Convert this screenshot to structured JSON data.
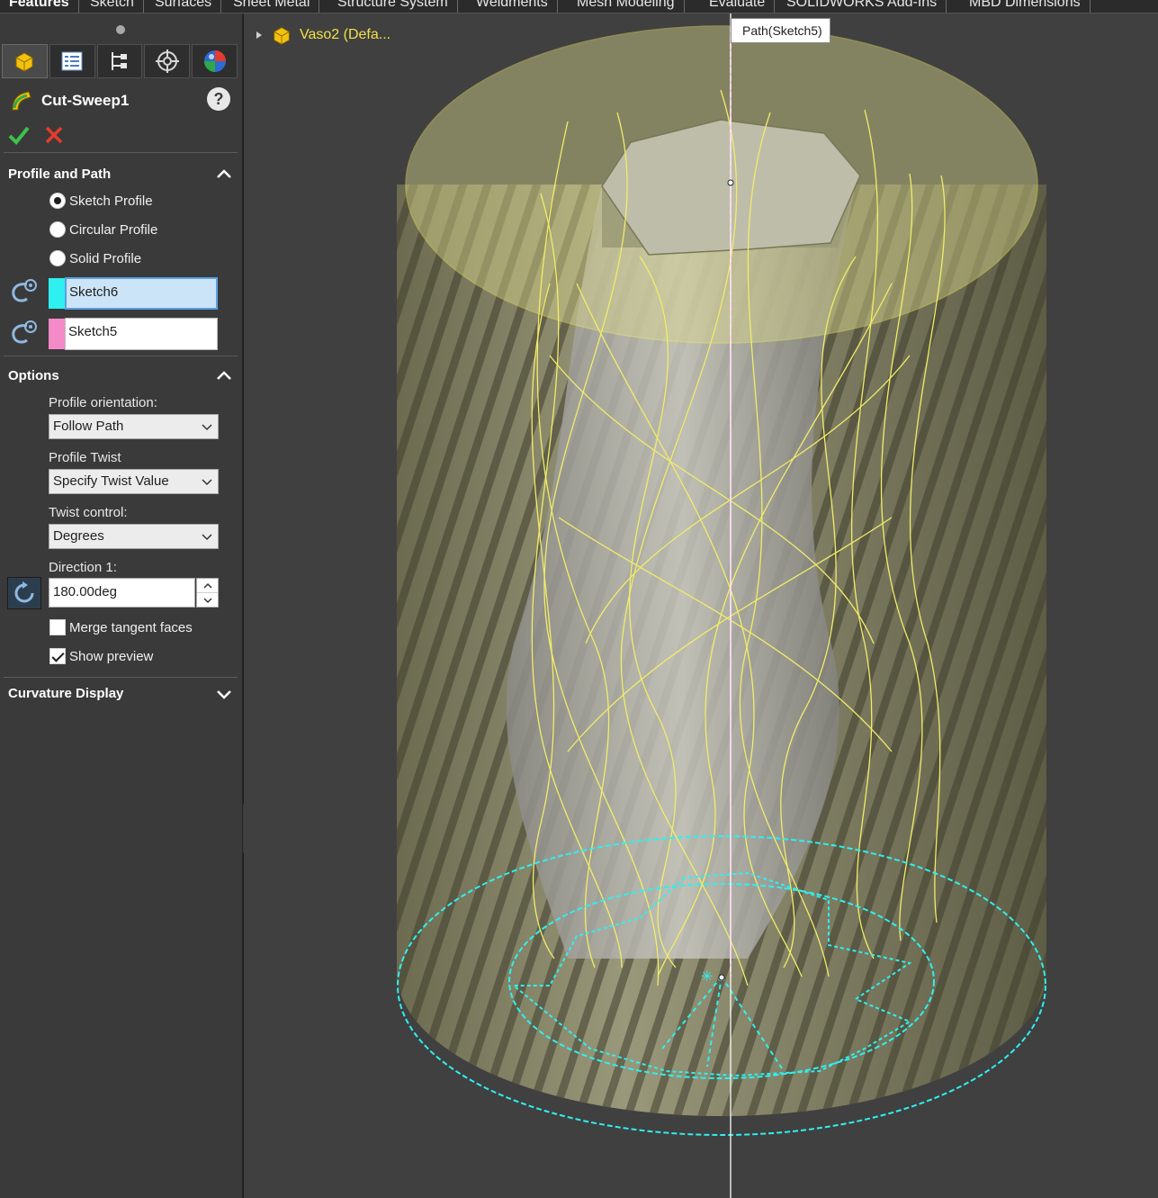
{
  "tabs": [
    "Features",
    "Sketch",
    "Surfaces",
    "Sheet Metal",
    "Structure System",
    "Weldments",
    "Mesh Modeling",
    "Evaluate",
    "SOLIDWORKS Add-Ins",
    "MBD Dimensions"
  ],
  "panel": {
    "feature_title": "Cut-Sweep1",
    "help_label": "?",
    "profile_and_path": {
      "heading": "Profile and Path",
      "radio_options": [
        {
          "label": "Sketch Profile",
          "selected": true
        },
        {
          "label": "Circular Profile",
          "selected": false
        },
        {
          "label": "Solid Profile",
          "selected": false
        }
      ],
      "profile_selection": {
        "value": "Sketch6",
        "color": "#2ef0f0"
      },
      "path_selection": {
        "value": "Sketch5",
        "color": "#f58ac8"
      }
    },
    "options": {
      "heading": "Options",
      "profile_orientation_label": "Profile orientation:",
      "profile_orientation_value": "Follow Path",
      "profile_twist_label": "Profile Twist",
      "profile_twist_value": "Specify Twist Value",
      "twist_control_label": "Twist control:",
      "twist_control_value": "Degrees",
      "direction1_label": "Direction 1:",
      "direction1_value": "180.00deg",
      "merge_tangent_faces": {
        "label": "Merge tangent faces",
        "checked": false
      },
      "show_preview": {
        "label": "Show preview",
        "checked": true
      }
    },
    "curvature_display": {
      "heading": "Curvature Display"
    }
  },
  "viewport": {
    "tree_node_label": "Vaso2  (Defa...",
    "tooltip": "Path(Sketch5)",
    "colors": {
      "preview_yellow": "#f2ec6a",
      "profile_cyan": "#2ef0f0",
      "path_pink": "#f58ac8",
      "background": "#404040",
      "body_olive": "#8c8b6a"
    }
  }
}
